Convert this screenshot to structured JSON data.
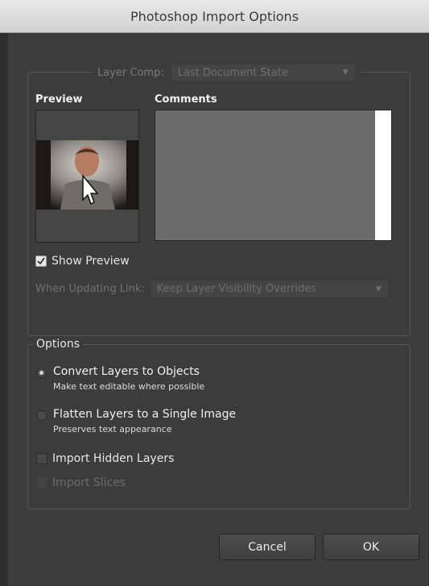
{
  "window": {
    "title": "Photoshop Import Options"
  },
  "layer_comp": {
    "label": "Layer Comp:",
    "value": "Last Document State"
  },
  "preview": {
    "header": "Preview"
  },
  "comments": {
    "header": "Comments"
  },
  "show_preview": {
    "label": "Show Preview",
    "checked": true
  },
  "updating_link": {
    "label": "When Updating Link:",
    "value": "Keep Layer Visibility Overrides"
  },
  "options": {
    "title": "Options",
    "convert": {
      "label": "Convert Layers to Objects",
      "sub": "Make text editable where possible",
      "selected": true
    },
    "flatten": {
      "label": "Flatten Layers to a Single Image",
      "sub": "Preserves text appearance",
      "selected": false
    },
    "import_hidden": {
      "label": "Import Hidden Layers",
      "checked": false
    },
    "import_slices": {
      "label": "Import Slices",
      "checked": false,
      "disabled": true
    }
  },
  "buttons": {
    "cancel": "Cancel",
    "ok": "OK"
  }
}
